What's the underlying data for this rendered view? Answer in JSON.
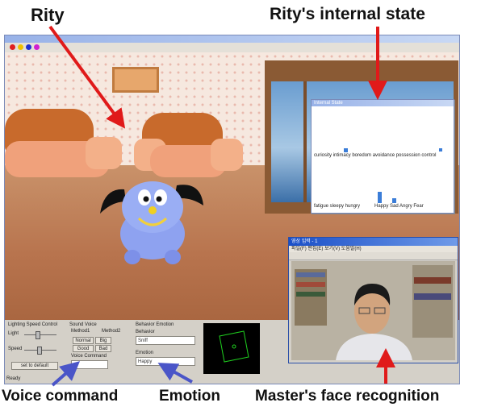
{
  "callouts": {
    "rity": "Rity",
    "internal_state": "Rity's internal state",
    "voice_command": "Voice command",
    "emotion": "Emotion",
    "face_recognition": "Master's face recognition"
  },
  "colors": {
    "callout_arrow_red": "#e01a1a",
    "callout_arrow_blue": "#4a55c8",
    "state_bar": "#3b7dd8",
    "window_titlebar": "#1a4fc8"
  },
  "internal_state_panel": {
    "title": "Internal State",
    "motivation_labels": "curiosity  intimacy  boredom  avoidance  possession  control",
    "homeostasis_labels": "fatigue  sleepy  hungry",
    "emotion_labels": "Happy  Sad  Angry  Fear"
  },
  "control_panel": {
    "lighting_group": "Lighting  Speed Control",
    "light_label": "Light",
    "speed_label": "Speed",
    "default_button": "set to default",
    "sound_group": "Sound  Voice",
    "method1_label": "Method1",
    "method2_label": "Method2",
    "normal_button": "Normal",
    "big_button": "Big",
    "good_button": "Good",
    "bad_button": "Bad",
    "voice_command_label": "Voice Command",
    "behavior_group": "Behavior  Emotion",
    "behavior_label": "Behavior",
    "behavior_value": "Sniff",
    "emotion_label": "Emotion",
    "emotion_value": "Happy",
    "status_text": "Ready"
  },
  "face_window": {
    "title": "영상 입력 - 1",
    "menu": "파일(F)  편집(E)  보기(V)  도움말(H)"
  }
}
